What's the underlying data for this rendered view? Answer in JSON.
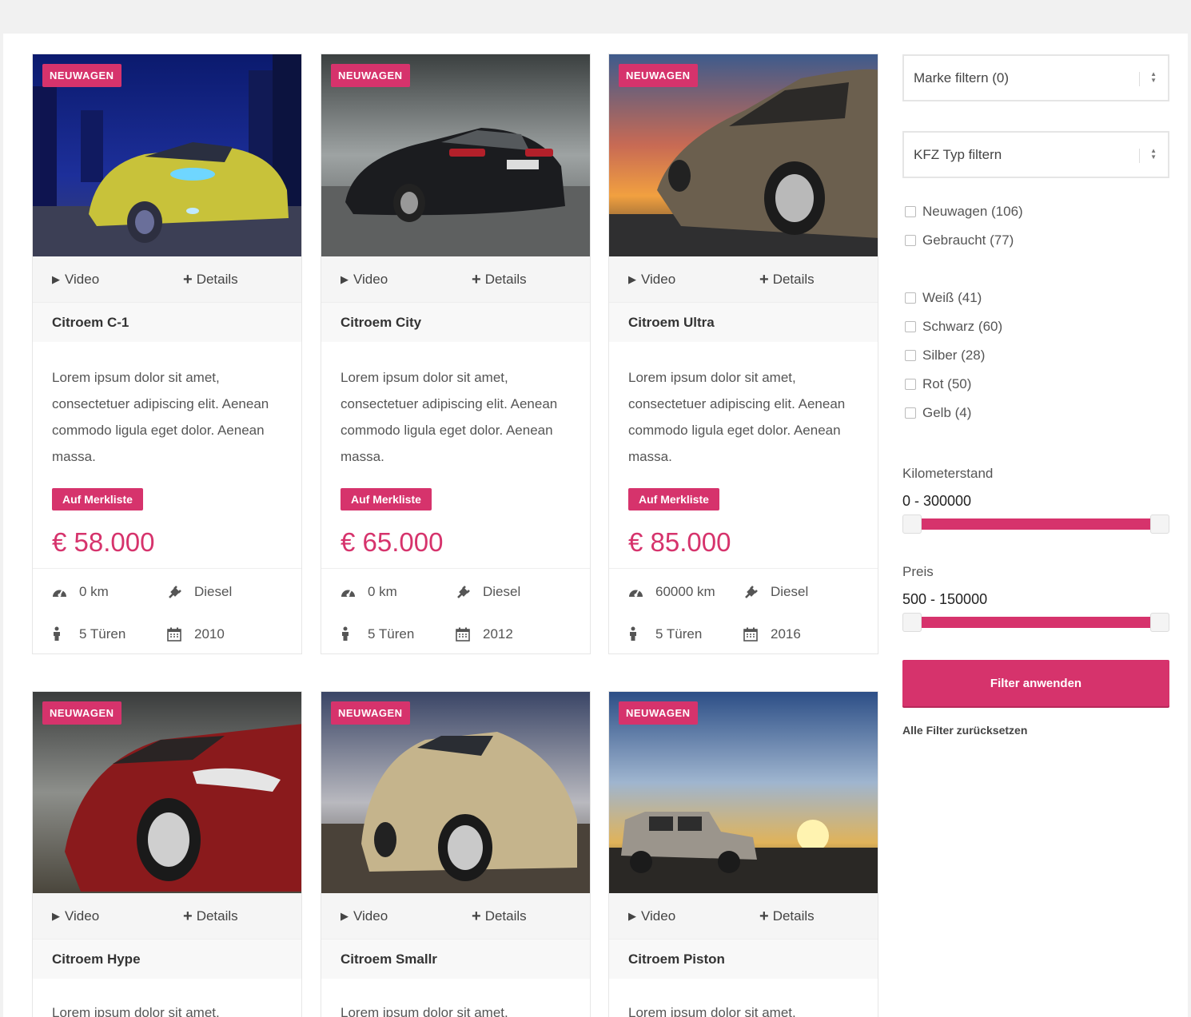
{
  "badge_label": "NEUWAGEN",
  "actions": {
    "video": "Video",
    "details": "Details"
  },
  "wishlist_label": "Auf Merkliste",
  "cars": [
    {
      "title": "Citroem C-1",
      "desc": "Lorem ipsum dolor sit amet, consectetuer adipiscing elit. Aenean commodo ligula eget dolor. Aenean massa.",
      "price": "€ 58.000",
      "km": "0 km",
      "fuel": "Diesel",
      "doors": "5 Türen",
      "year": "2010"
    },
    {
      "title": "Citroem City",
      "desc": "Lorem ipsum dolor sit amet, consectetuer adipiscing elit. Aenean commodo ligula eget dolor. Aenean massa.",
      "price": "€ 65.000",
      "km": "0 km",
      "fuel": "Diesel",
      "doors": "5 Türen",
      "year": "2012"
    },
    {
      "title": "Citroem Ultra",
      "desc": "Lorem ipsum dolor sit amet, consectetuer adipiscing elit. Aenean commodo ligula eget dolor. Aenean massa.",
      "price": "€ 85.000",
      "km": "60000 km",
      "fuel": "Diesel",
      "doors": "5 Türen",
      "year": "2016"
    },
    {
      "title": "Citroem Hype",
      "desc": "Lorem ipsum dolor sit amet,"
    },
    {
      "title": "Citroem Smallr",
      "desc": "Lorem ipsum dolor sit amet,"
    },
    {
      "title": "Citroem Piston",
      "desc": "Lorem ipsum dolor sit amet,"
    }
  ],
  "sidebar": {
    "brand_filter": "Marke filtern (0)",
    "type_filter": "KFZ Typ filtern",
    "condition": [
      {
        "label": "Neuwagen (106)"
      },
      {
        "label": "Gebraucht (77)"
      }
    ],
    "colors": [
      {
        "label": "Weiß (41)"
      },
      {
        "label": "Schwarz (60)"
      },
      {
        "label": "Silber (28)"
      },
      {
        "label": "Rot (50)"
      },
      {
        "label": "Gelb (4)"
      }
    ],
    "mileage": {
      "label": "Kilometerstand",
      "value": "0 - 300000"
    },
    "price": {
      "label": "Preis",
      "value": "500 - 150000"
    },
    "apply_label": "Filter anwenden",
    "reset_label": "Alle Filter zurücksetzen"
  },
  "colors": {
    "accent": "#d6336c"
  },
  "icons": {
    "video": "play-icon",
    "details": "plus-icon",
    "km": "speedometer-icon",
    "fuel": "plug-icon",
    "doors": "person-icon",
    "year": "calendar-icon"
  }
}
